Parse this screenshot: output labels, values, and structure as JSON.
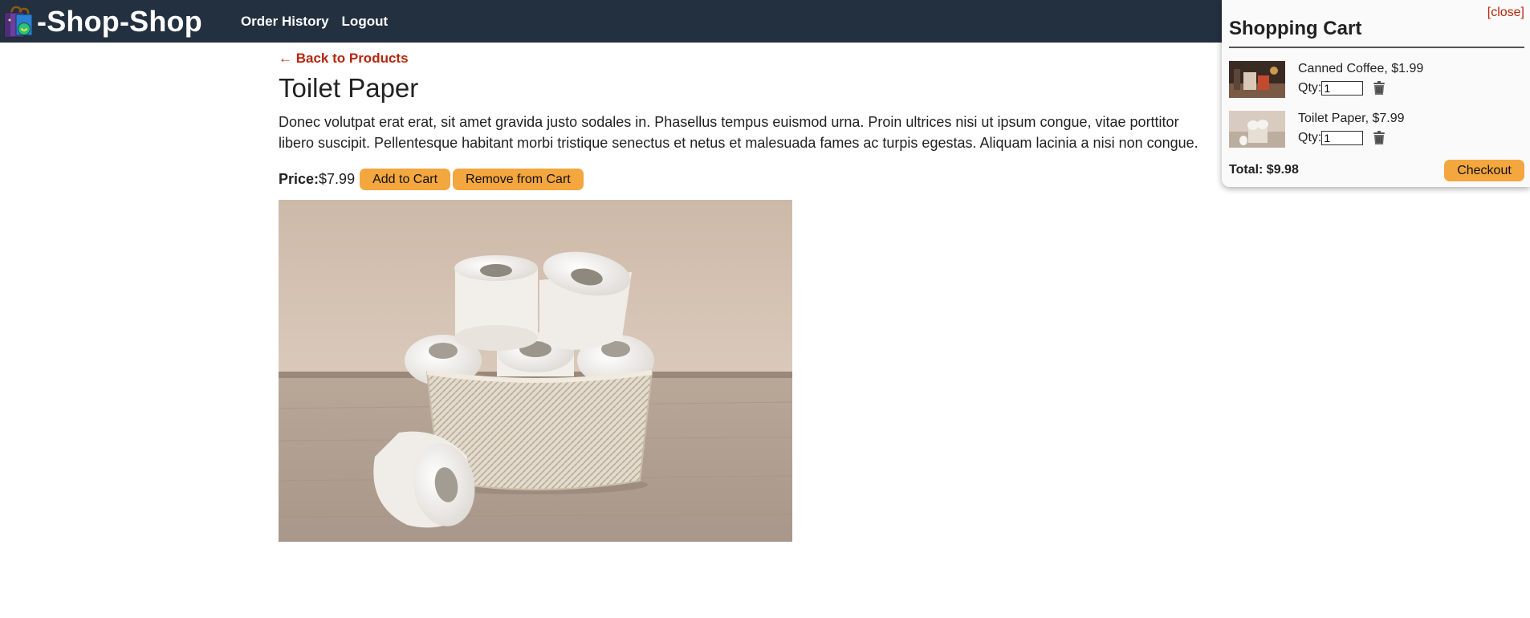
{
  "header": {
    "brand": "-Shop-Shop",
    "nav": [
      "Order History",
      "Logout"
    ]
  },
  "product": {
    "back_link": "← Back to Products",
    "title": "Toilet Paper",
    "description": "Donec volutpat erat erat, sit amet gravida justo sodales in. Phasellus tempus euismod urna. Proin ultrices nisi ut ipsum congue, vitae porttitor libero suscipit. Pellentesque habitant morbi tristique senectus et netus et malesuada fames ac turpis egestas. Aliquam lacinia a nisi non congue.",
    "price_label": "Price:",
    "price": "$7.99",
    "add_label": "Add to Cart",
    "remove_label": "Remove from Cart"
  },
  "cart": {
    "close_label": "[close]",
    "title": "Shopping Cart",
    "qty_label": "Qty:",
    "items": [
      {
        "name": "Canned Coffee, $1.99",
        "qty": "1"
      },
      {
        "name": "Toilet Paper, $7.99",
        "qty": "1"
      }
    ],
    "total": "Total: $9.98",
    "checkout_label": "Checkout"
  },
  "colors": {
    "header_bg": "#23303f",
    "accent_button": "#f4a63f",
    "link": "#b5260d"
  },
  "icons": [
    "shopping-bag-icon",
    "trash-icon"
  ]
}
